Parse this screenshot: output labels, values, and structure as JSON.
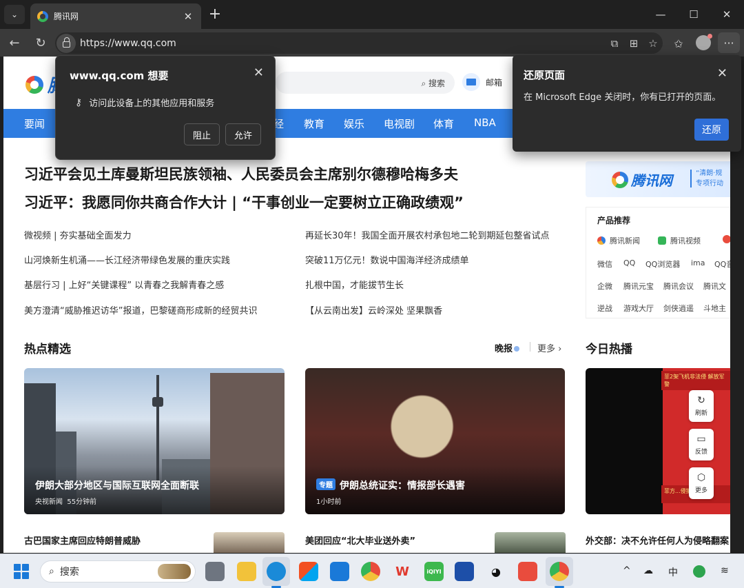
{
  "browser": {
    "tab_title": "腾讯网",
    "url": "https://www.qq.com"
  },
  "permission_popup": {
    "title": "www.qq.com 想要",
    "request": "访问此设备上的其他应用和服务",
    "block_label": "阻止",
    "allow_label": "允许"
  },
  "restore_popup": {
    "title": "还原页面",
    "body": "在 Microsoft Edge 关闭时，你有已打开的页面。",
    "restore_label": "还原"
  },
  "page": {
    "search_button": "搜索",
    "mail_label": "邮箱",
    "nav": [
      "要闻",
      "经",
      "教育",
      "娱乐",
      "电视剧",
      "体育",
      "NBA"
    ],
    "headlines": [
      "习近平会见土库曼斯坦民族领袖、人民委员会主席别尔德穆哈梅多夫",
      "习近平：我愿同你共商合作大计 | “干事创业一定要树立正确政绩观”"
    ],
    "news_left": [
      "微视频 | 夯实基础全面发力",
      "山河焕新生机涌——长江经济带绿色发展的重庆实践",
      "基层行习 | 上好“关键课程” 以青春之我解青春之感",
      "美方澄清“威胁推迟访华”报道，巴黎磋商形成新的经贸共识"
    ],
    "news_right": [
      "再延长30年！我国全面开展农村承包地二轮到期延包整省试点",
      "突破11万亿元！数说中国海洋经济成绩单",
      "扎根中国，才能拔节生长",
      "【从云南出发】云岭深处 坚果飘香"
    ],
    "hot_title": "热点精选",
    "morning_label": "晚报",
    "more_label": "更多",
    "cards": [
      {
        "title": "伊朗大部分地区与国际互联网全面断联",
        "source": "央视新闻",
        "time": "55分钟前",
        "badge": ""
      },
      {
        "title": "伊朗总统证实：情报部长遇害",
        "source": "",
        "time": "1小时前",
        "badge": "专题"
      }
    ],
    "bottom_titles": [
      "古巴国家主席回应特朗普威胁",
      "美团回应“北大毕业送外卖”"
    ],
    "right": {
      "logo_text": "腾讯网",
      "slogan_lines": [
        "“清朗·规",
        "专项行动"
      ],
      "products_title": "产品推荐",
      "featured": [
        "腾讯新闻",
        "腾讯视频"
      ],
      "row1": [
        "微信",
        "QQ",
        "QQ浏览器",
        "ima",
        "QQ音"
      ],
      "row2": [
        "企微",
        "腾讯元宝",
        "腾讯会议",
        "腾讯文"
      ],
      "row3": [
        "逆战",
        "游戏大厅",
        "剑侠逍遥",
        "斗地主"
      ],
      "today_title": "今日热播",
      "live_band": "菲2架飞机非法侵\n解放军警",
      "live_band_bottom": "菲方...侵犯...",
      "tools": [
        "刷新",
        "反馈",
        "更多"
      ],
      "bottom_title": "外交部：决不允许任何人为侵略翻案"
    }
  },
  "taskbar": {
    "search_placeholder": "搜索",
    "ime_label": "中"
  },
  "colors": {
    "brand_blue": "#2f7de1",
    "popup_bg": "#2c2c2c",
    "restore_button": "#2f6fd8"
  }
}
